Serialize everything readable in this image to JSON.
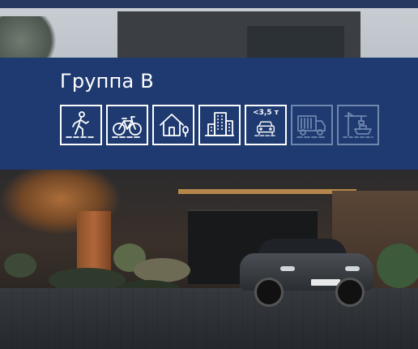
{
  "panel": {
    "title": "Группа В",
    "icons": [
      {
        "icon": "pedestrian-icon",
        "active": true
      },
      {
        "icon": "bicycle-icon",
        "active": true
      },
      {
        "icon": "house-icon",
        "active": true
      },
      {
        "icon": "building-icon",
        "active": true
      },
      {
        "icon": "car-icon",
        "label": "<3,5 т",
        "active": true
      },
      {
        "icon": "truck-icon",
        "active": false
      },
      {
        "icon": "crane-ship-icon",
        "active": false
      }
    ],
    "colors": {
      "background": "#1e3a70",
      "active": "#ffffff",
      "inactive": "#6f86ad"
    }
  }
}
